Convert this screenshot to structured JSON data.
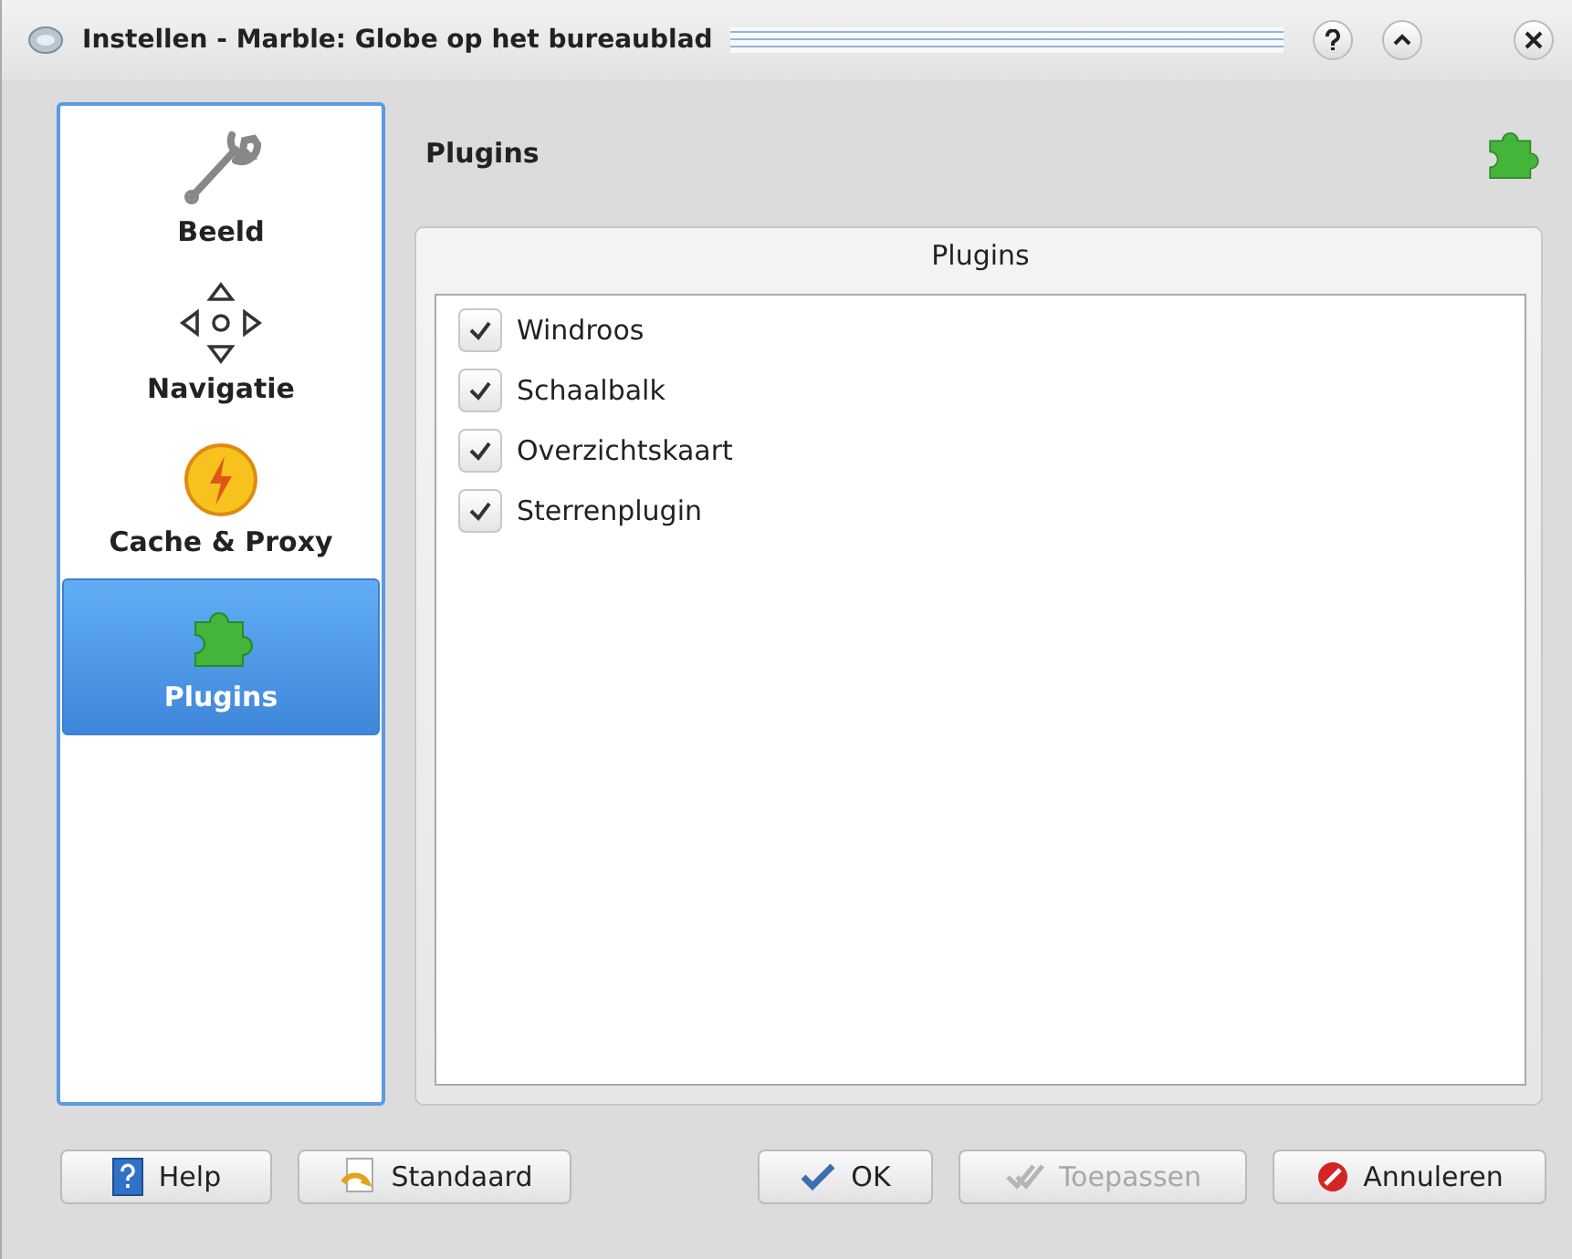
{
  "window": {
    "title": "Instellen - Marble: Globe op het bureaublad"
  },
  "sidebar": {
    "items": [
      {
        "label": "Beeld",
        "selected": false
      },
      {
        "label": "Navigatie",
        "selected": false
      },
      {
        "label": "Cache & Proxy",
        "selected": false
      },
      {
        "label": "Plugins",
        "selected": true
      }
    ]
  },
  "page": {
    "title": "Plugins",
    "group_title": "Plugins",
    "plugins": [
      {
        "label": "Windroos",
        "checked": true
      },
      {
        "label": "Schaalbalk",
        "checked": true
      },
      {
        "label": "Overzichtskaart",
        "checked": true
      },
      {
        "label": "Sterrenplugin",
        "checked": true
      }
    ]
  },
  "buttons": [
    {
      "label": "Help",
      "disabled": false
    },
    {
      "label": "Standaard",
      "disabled": false
    },
    {
      "label": "OK",
      "disabled": false
    },
    {
      "label": "Toepassen",
      "disabled": true
    },
    {
      "label": "Annuleren",
      "disabled": false
    }
  ]
}
